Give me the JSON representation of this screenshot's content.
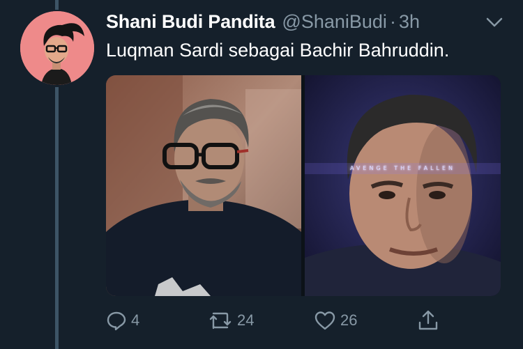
{
  "tweet": {
    "display_name": "Shani Budi Pandita",
    "handle": "@ShaniBudi",
    "separator": "·",
    "time": "3h",
    "text": "Luqman Sardi sebagai Bachir Bahruddin.",
    "media": [
      {
        "icon": "photo-of-man-with-glasses"
      },
      {
        "icon": "avengers-poster-photo",
        "overlay_text": "AVENGE THE FALLEN"
      }
    ]
  },
  "actions": {
    "reply_count": "4",
    "retweet_count": "24",
    "like_count": "26"
  },
  "colors": {
    "background": "#15202b",
    "secondary_text": "#8899a6",
    "primary_text": "#ffffff",
    "thread_line": "#3d5466"
  }
}
